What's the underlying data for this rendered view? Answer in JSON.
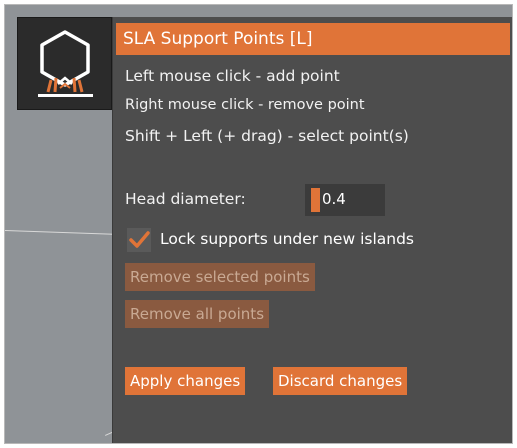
{
  "panel": {
    "title": "SLA Support Points [L]",
    "help_lines": [
      "Left mouse click - add point",
      "Right mouse click - remove point",
      "Shift + Left (+ drag) - select point(s)"
    ],
    "head_diameter": {
      "label": "Head diameter:",
      "value": "0.4"
    },
    "lock_supports": {
      "label": "Lock supports under new islands",
      "checked": true
    },
    "buttons": {
      "remove_selected": "Remove selected points",
      "remove_all": "Remove all points",
      "apply": "Apply changes",
      "discard": "Discard changes"
    }
  },
  "toolbar": {
    "icon": "sla-support-points-icon"
  },
  "colors": {
    "accent": "#e07438",
    "panel_bg": "#4d4d4d",
    "viewport_bg": "#8f9397",
    "disabled_button": "#8a5a40"
  }
}
